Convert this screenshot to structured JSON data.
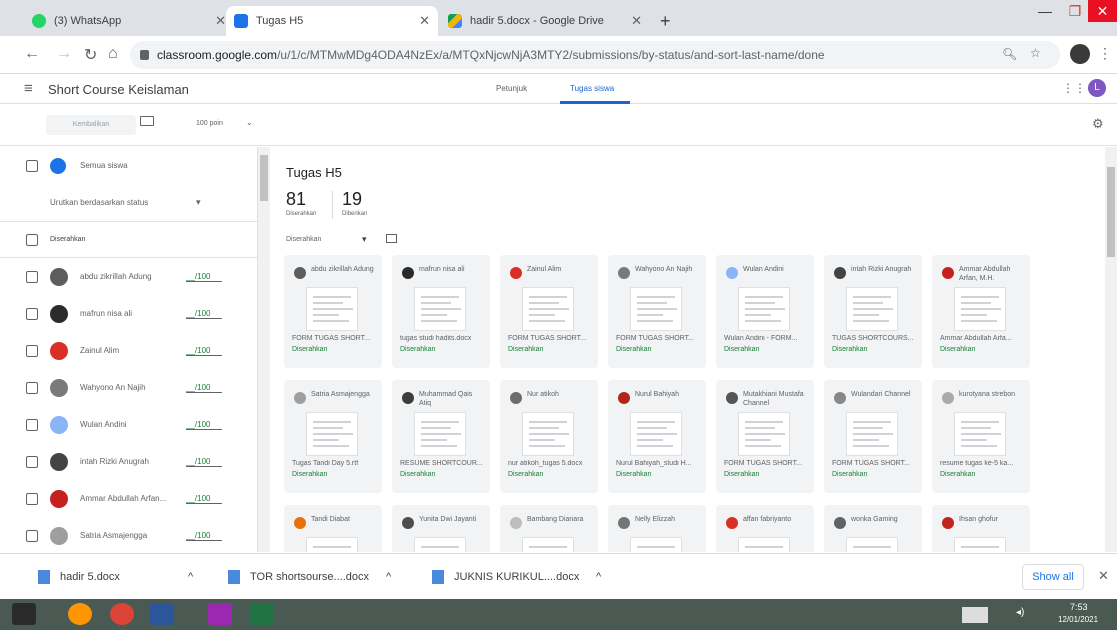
{
  "browser": {
    "tabs": [
      {
        "title": "(3) WhatsApp",
        "color": "#25d366"
      },
      {
        "title": "Tugas H5",
        "color": "#1a73e8"
      },
      {
        "title": "hadir 5.docx - Google Drive",
        "color": "#f4b400"
      }
    ],
    "new_tab": "+",
    "url_host": "classroom.google.com",
    "url_path": "/u/1/c/MTMwMDg4ODA4NzEx/a/MTQxNjcwNjA3MTY2/submissions/by-status/and-sort-last-name/done"
  },
  "app": {
    "course_title": "Short Course Keislaman",
    "tab_instructions": "Petunjuk",
    "tab_student_work": "Tugas siswa",
    "return_button": "Kembalikan",
    "points": "100 poin",
    "account_initial": "L"
  },
  "left": {
    "all_students": "Semua siswa",
    "sort_label": "Urutkan berdasarkan status",
    "section_handed_in": "Diserahkan",
    "students": [
      {
        "name": "abdu zikrillah Adung",
        "grade": "__/100",
        "color": "#5d5d5d"
      },
      {
        "name": "mafrun nisa ali",
        "grade": "__/100",
        "color": "#2b2b2b"
      },
      {
        "name": "Zainul Alim",
        "grade": "__/100",
        "color": "#d93025"
      },
      {
        "name": "Wahyono An Najih",
        "grade": "__/100",
        "color": "#7a7a7a"
      },
      {
        "name": "Wulan Andini",
        "grade": "__/100",
        "color": "#8ab4f8"
      },
      {
        "name": "intah Rizki Anugrah",
        "grade": "__/100",
        "color": "#444444"
      },
      {
        "name": "Ammar Abdullah Arfan...",
        "grade": "__/100",
        "color": "#c5221f"
      },
      {
        "name": "Satria Asmajengga",
        "grade": "__/100",
        "color": "#9e9e9e"
      }
    ]
  },
  "main": {
    "assignment_title": "Tugas H5",
    "handed_in_count": "81",
    "handed_in_label": "Diserahkan",
    "assigned_count": "19",
    "assigned_label": "Diberikan",
    "filter_label": "Diserahkan",
    "cards": [
      {
        "name": "abdu zikrillah Adung",
        "file": "FORM TUGAS SHORT...",
        "status": "Diserahkan",
        "color": "#5d5d5d"
      },
      {
        "name": "mafrun nisa ali",
        "file": "tugas studi hadits.docx",
        "status": "Diserahkan",
        "color": "#2b2b2b"
      },
      {
        "name": "Zainul Alim",
        "file": "FORM TUGAS SHORT...",
        "status": "Diserahkan",
        "color": "#d93025"
      },
      {
        "name": "Wahyono An Najih",
        "file": "FORM TUGAS SHORT...",
        "status": "Diserahkan",
        "color": "#7a7a7a"
      },
      {
        "name": "Wulan Andini",
        "file": "Wulan Andini - FORM...",
        "status": "Diserahkan",
        "color": "#8ab4f8"
      },
      {
        "name": "intah Rizki Anugrah",
        "file": "TUGAS SHORTCOURS...",
        "status": "Diserahkan",
        "color": "#444444"
      },
      {
        "name": "Ammar Abdullah Arfan, M.H.",
        "file": "Ammar Abdullah Arfa...",
        "status": "Diserahkan",
        "color": "#c5221f"
      },
      {
        "name": "Satria Asmajengga",
        "file": "Tugas Tandi Day 5.rtf",
        "status": "Diserahkan",
        "color": "#9e9e9e"
      },
      {
        "name": "Muhammad Qais Atiq",
        "file": "RESUME SHORTCOUR...",
        "status": "Diserahkan",
        "color": "#3c3c3c"
      },
      {
        "name": "Nur atikoh",
        "file": "nur atikoh_tugas 5.docx",
        "status": "Diserahkan",
        "color": "#6d6d6d"
      },
      {
        "name": "Nurul Bahiyah",
        "file": "Nurul Bahiyah_studi H...",
        "status": "Diserahkan",
        "color": "#b3261e"
      },
      {
        "name": "Mutakhiani Mustafa Channel",
        "file": "FORM TUGAS SHORT...",
        "status": "Diserahkan",
        "color": "#555555"
      },
      {
        "name": "Wulandari Channel",
        "file": "FORM TUGAS SHORT...",
        "status": "Diserahkan",
        "color": "#888888"
      },
      {
        "name": "kurotyana strebon",
        "file": "resume tugas ke-5 ka...",
        "status": "Diserahkan",
        "color": "#aaaaaa"
      },
      {
        "name": "Tandi Diabat",
        "file": "",
        "status": "",
        "color": "#e8710a"
      },
      {
        "name": "Yunita Dwi Jayanti",
        "file": "",
        "status": "",
        "color": "#4e4e4e"
      },
      {
        "name": "Bambang Dianara",
        "file": "",
        "status": "",
        "color": "#bdbdbd"
      },
      {
        "name": "Nelly Elizzah",
        "file": "",
        "status": "",
        "color": "#757575"
      },
      {
        "name": "affan fabriyanto",
        "file": "",
        "status": "",
        "color": "#d93025"
      },
      {
        "name": "wonka Gaming",
        "file": "",
        "status": "",
        "color": "#5f6368"
      },
      {
        "name": "Ihsan ghofur",
        "file": "",
        "status": "",
        "color": "#c5221f"
      }
    ]
  },
  "downloads": {
    "items": [
      "hadir 5.docx",
      "TOR shortsourse....docx",
      "JUKNIS KURIKUL....docx"
    ],
    "show_all": "Show all"
  },
  "taskbar": {
    "time": "7:53",
    "date": "12/01/2021"
  }
}
